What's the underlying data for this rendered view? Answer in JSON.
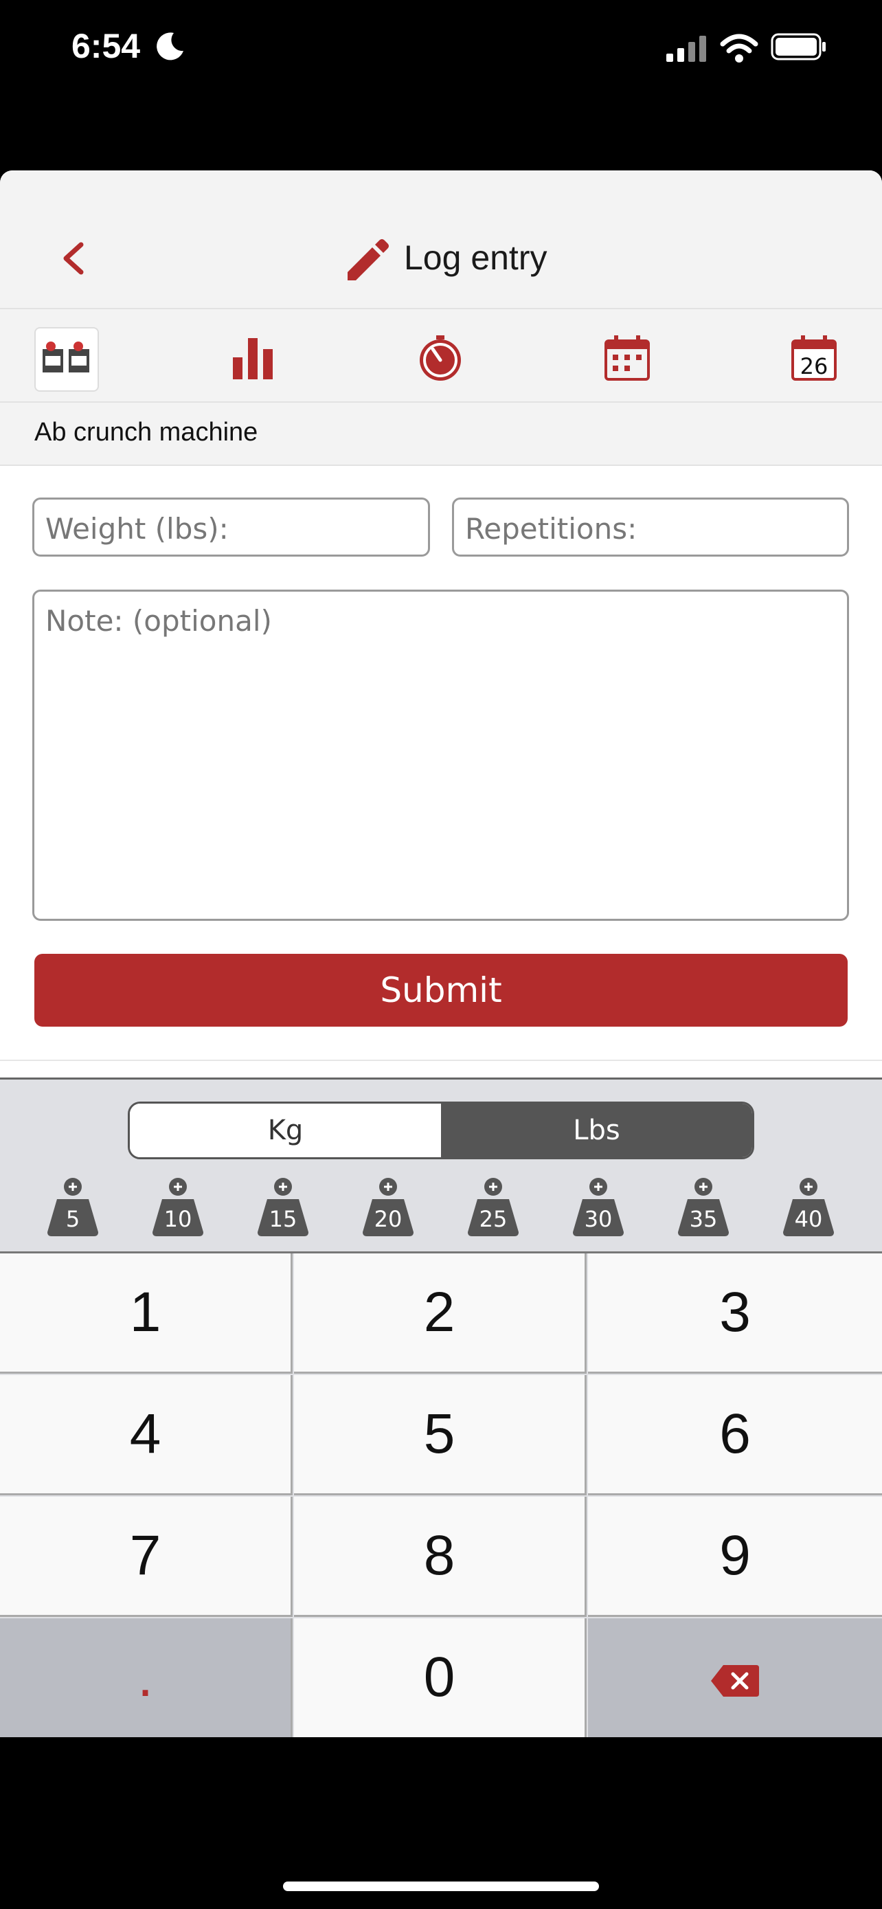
{
  "status": {
    "time": "6:54"
  },
  "header": {
    "title": "Log entry"
  },
  "exercise": {
    "name": "Ab crunch machine"
  },
  "calendar_day": "26",
  "form": {
    "weight_placeholder": "Weight (lbs):",
    "reps_placeholder": "Repetitions:",
    "note_placeholder": "Note: (optional)",
    "submit_label": "Submit"
  },
  "units": {
    "options": [
      "Kg",
      "Lbs"
    ],
    "selected": "Lbs"
  },
  "weights": [
    "5",
    "10",
    "15",
    "20",
    "25",
    "30",
    "35",
    "40"
  ],
  "keypad": [
    "1",
    "2",
    "3",
    "4",
    "5",
    "6",
    "7",
    "8",
    "9",
    ".",
    "0"
  ],
  "colors": {
    "accent": "#b22c2c",
    "keyboard_bg": "#dfe0e4",
    "selected_unit": "#555555"
  }
}
